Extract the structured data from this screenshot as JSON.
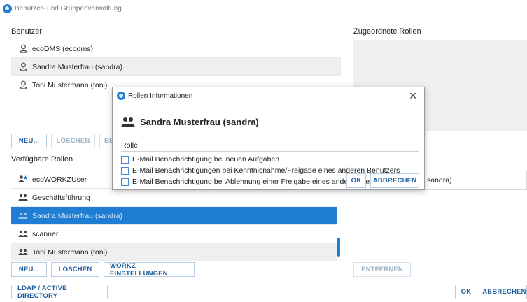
{
  "window": {
    "title": "Benutzer- und Gruppenverwaltung"
  },
  "users": {
    "label": "Benutzer",
    "items": [
      {
        "name": "ecoDMS (ecodms)"
      },
      {
        "name": "Sandra Musterfrau (sandra)"
      },
      {
        "name": "Toni Mustermann (toni)"
      }
    ],
    "buttons": {
      "new": "NEU...",
      "delete": "LÖSCHEN",
      "edit_partial": "BE"
    }
  },
  "assigned_roles": {
    "label": "Zugeordnete Rollen",
    "field_value": "sandra)",
    "remove": "ENTFERNEN"
  },
  "available_roles": {
    "label": "Verfügbare Rollen",
    "items": [
      {
        "name": "ecoWORKZUser",
        "icon": "group-star-icon"
      },
      {
        "name": "Geschäftsführung",
        "icon": "group-icon"
      },
      {
        "name": "Sandra Musterfrau (sandra)",
        "icon": "group-icon"
      },
      {
        "name": "scanner",
        "icon": "group-icon"
      },
      {
        "name": "Toni Mustermann (toni)",
        "icon": "group-icon"
      }
    ],
    "buttons": {
      "new": "NEU...",
      "delete": "LÖSCHEN",
      "workz": "WORKZ EINSTELLUNGEN"
    }
  },
  "footer": {
    "ldap": "LDAP / ACTIVE DIRECTORY",
    "ok": "OK",
    "cancel": "ABBRECHEN"
  },
  "dialog": {
    "title": "Rollen Informationen",
    "user": "Sandra Musterfrau (sandra)",
    "role_label": "Rolle",
    "options": [
      "E-Mail Benachrichtigung bei neuen Aufgaben",
      "E-Mail Benachrichtigungen bei Kenntnisnahme/Freigabe eines anderen Benutzers",
      "E-Mail Benachrichtigung bei Ablehnung einer Freigabe eines anderen Benutzers"
    ],
    "ok": "OK",
    "cancel": "ABBRECHEN"
  },
  "colors": {
    "accent": "#1f7dd4",
    "selected_row": "#1f7dd4",
    "button_text": "#1f5f9f"
  }
}
